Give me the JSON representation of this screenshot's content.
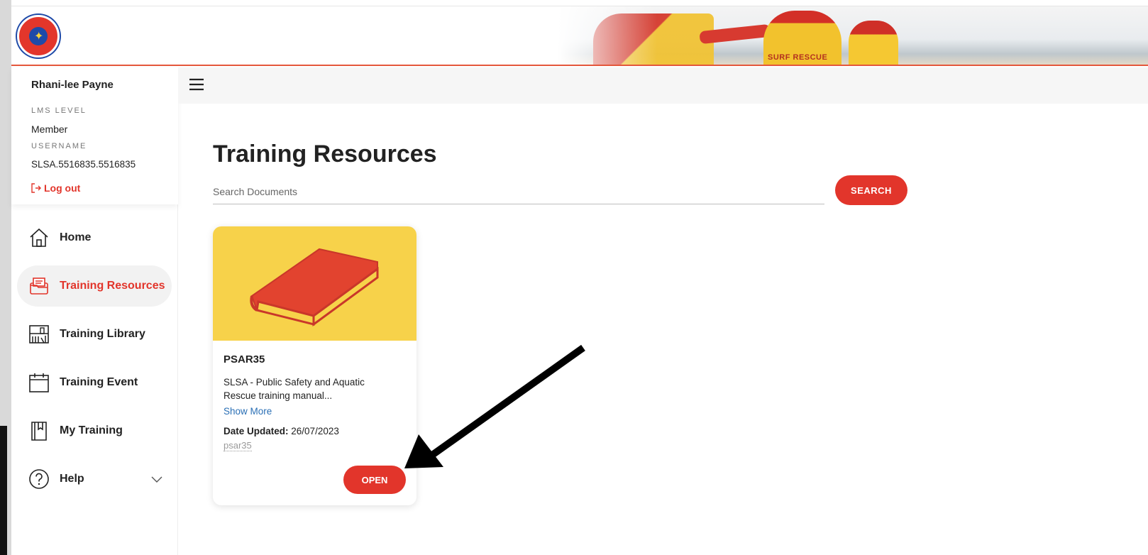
{
  "header": {
    "logo_icon": "surf-life-saving-logo",
    "banner_text": "SURF RESCUE"
  },
  "user": {
    "name": "Rhani-lee Payne",
    "lms_level_label": "LMS LEVEL",
    "lms_level_value": "Member",
    "username_label": "USERNAME",
    "username_value": "SLSA.5516835.5516835",
    "logout_label": "Log out"
  },
  "sidebar": {
    "items": [
      {
        "label": "Home",
        "icon": "home-icon",
        "active": false
      },
      {
        "label": "Training Resources",
        "icon": "folder-icon",
        "active": true
      },
      {
        "label": "Training Library",
        "icon": "library-icon",
        "active": false
      },
      {
        "label": "Training Event",
        "icon": "calendar-icon",
        "active": false
      },
      {
        "label": "My Training",
        "icon": "bookmark-book-icon",
        "active": false
      },
      {
        "label": "Help",
        "icon": "help-icon",
        "active": false
      }
    ]
  },
  "main": {
    "title": "Training Resources",
    "search_placeholder": "Search Documents",
    "search_button": "SEARCH"
  },
  "card": {
    "title": "PSAR35",
    "description": "SLSA - Public Safety and Aquatic Rescue training manual...",
    "show_more": "Show More",
    "date_label": "Date Updated:",
    "date_value": "26/07/2023",
    "tag": "psar35",
    "open_button": "OPEN",
    "image_icon": "book-icon"
  },
  "colors": {
    "accent": "#e2352b",
    "card_image_bg": "#f7d24a",
    "link": "#2a6fb5"
  }
}
